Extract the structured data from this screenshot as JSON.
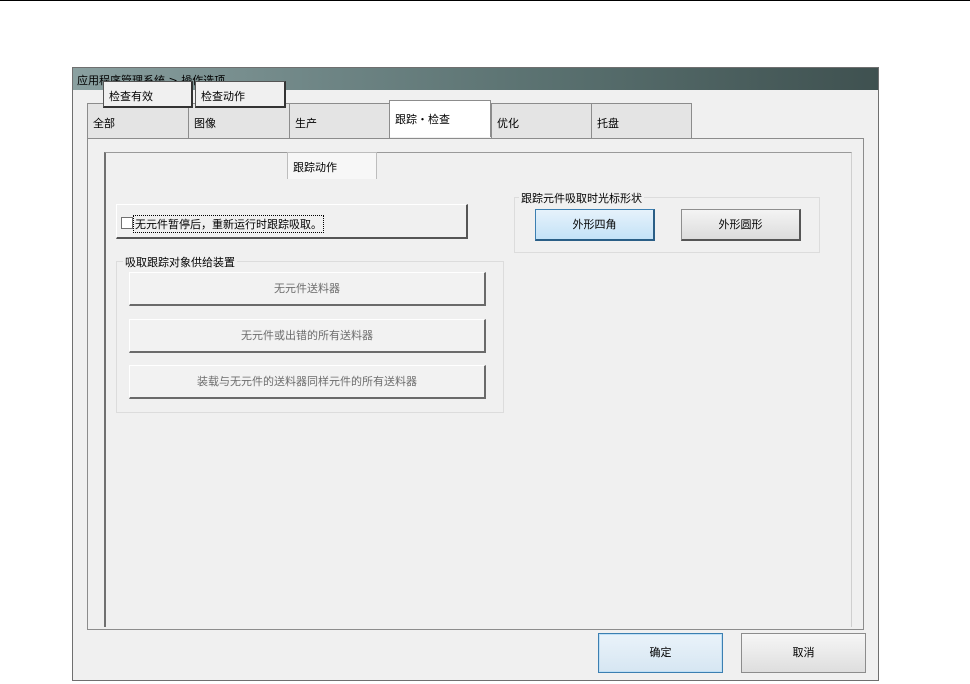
{
  "window": {
    "title": "应用程序管理系统 > 操作选项"
  },
  "tabs": [
    {
      "label": "全部",
      "active": false
    },
    {
      "label": "图像",
      "active": false
    },
    {
      "label": "生产",
      "active": false
    },
    {
      "label": "跟踪・检查",
      "active": true
    },
    {
      "label": "优化",
      "active": false
    },
    {
      "label": "托盘",
      "active": false
    }
  ],
  "subtabs": [
    {
      "label": "检查有效",
      "active": false
    },
    {
      "label": "检查动作",
      "active": false
    },
    {
      "label": "跟踪动作",
      "active": true
    }
  ],
  "tracking": {
    "rerun_checkbox": {
      "label": "无元件暂停后，重新运行时跟踪吸取。",
      "checked": false
    },
    "feeder_group": {
      "title": "吸取跟踪对象供给装置",
      "options": [
        "无元件送料器",
        "无元件或出错的所有送料器",
        "装载与无元件的送料器同样元件的所有送料器"
      ]
    },
    "cursor_group": {
      "title": "跟踪元件吸取时光标形状",
      "options": [
        "外形四角",
        "外形圆形"
      ],
      "selected": "外形四角"
    }
  },
  "buttons": {
    "ok": "确定",
    "cancel": "取消"
  },
  "colors": {
    "selected_button": "#c4e2f7",
    "selected_border": "#3c7fb1",
    "window_bg": "#f0f0f0"
  }
}
